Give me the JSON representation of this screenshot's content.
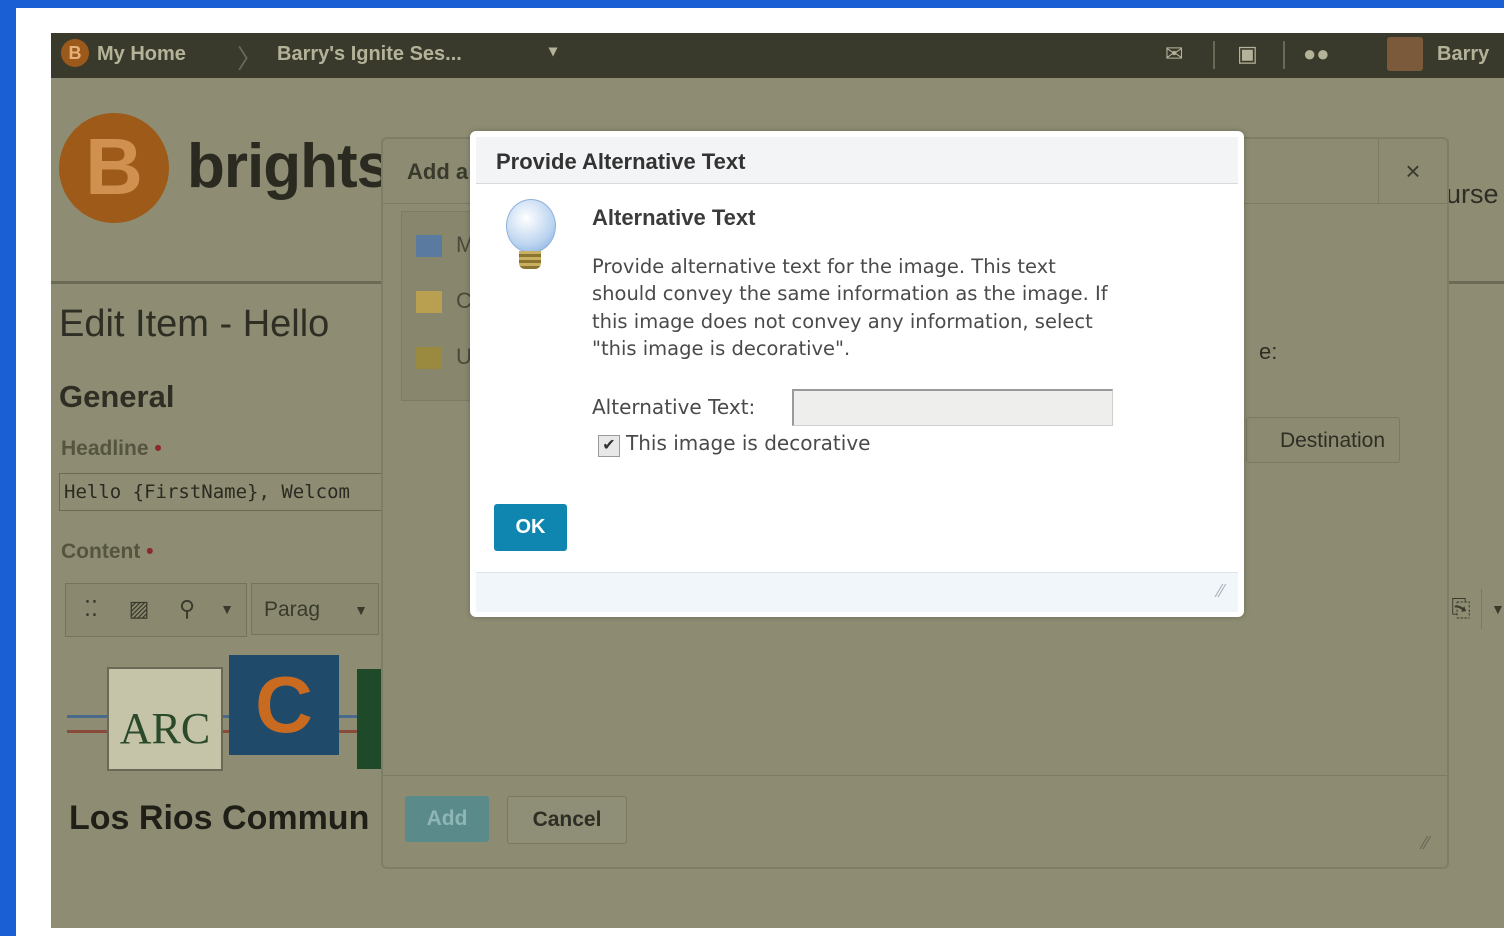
{
  "topnav": {
    "home_icon": "brightspace-logo-icon",
    "home": "My Home",
    "separator": "〉",
    "course": "Barry's Ignite Ses...",
    "course_dropdown": "▾",
    "user": "Barry",
    "icons": [
      "message-icon",
      "subscriptions-icon",
      "updates-icon"
    ]
  },
  "page": {
    "logo_letter": "B",
    "brand": "brights",
    "edit_title": "Edit Item - Hello",
    "section_general": "General",
    "headline_label": "Headline",
    "required_marker": "•",
    "headline_value": "Hello {FirstName}, Welcom",
    "content_label": "Content",
    "paragraph_select": "Parag",
    "college_name": "Los Rios Commun",
    "logo_arc_text": "ARC",
    "logo_c_text": "C",
    "course_partial": "urse",
    "colon_partial": "e:",
    "destination_button": "Destination"
  },
  "add_dialog": {
    "title": "Add a",
    "close": "×",
    "menu_items": [
      {
        "label": "My",
        "icon": "computer-icon"
      },
      {
        "label": "Co",
        "icon": "folder-icon"
      },
      {
        "label": "UR",
        "icon": "url-icon"
      }
    ],
    "add_button": "Add",
    "cancel_button": "Cancel"
  },
  "modal": {
    "title": "Provide Alternative Text",
    "heading": "Alternative Text",
    "description": "Provide alternative text for the image. This text\nshould convey the same information as the image. If\nthis image does not convey any information, select\n\"this image is decorative\".",
    "alt_label": "Alternative Text:",
    "alt_value": "",
    "decorative_checked": true,
    "decorative_label": "This image is decorative",
    "ok_button": "OK",
    "check_mark": "✔"
  },
  "colors": {
    "ok_button": "#0e86b0",
    "overlay": "#8e8d74",
    "frame_border": "#1a5fd4",
    "brand_orange": "#9e5a18"
  }
}
